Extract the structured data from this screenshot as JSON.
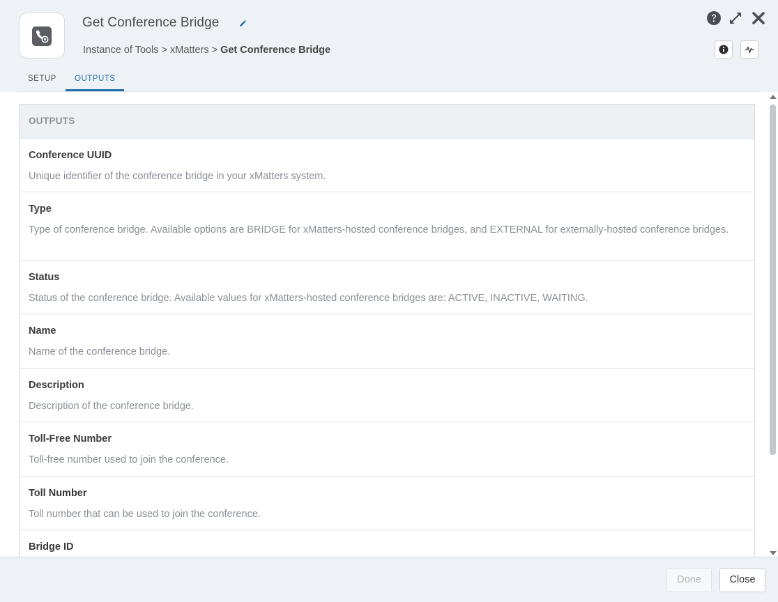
{
  "window": {
    "title": "Get Conference Bridge",
    "icon_name": "phone-gear-icon",
    "breadcrumb": {
      "items": [
        "Instance of Tools",
        "xMatters"
      ],
      "separator": ">",
      "current": "Get Conference Bridge"
    },
    "top_icons": [
      "help-icon",
      "expand-icon",
      "close-icon"
    ],
    "side_buttons": [
      "info-icon",
      "activity-icon"
    ]
  },
  "tabs": [
    {
      "label": "SETUP",
      "active": false
    },
    {
      "label": "OUTPUTS",
      "active": true
    }
  ],
  "outputs": {
    "header": "OUTPUTS",
    "items": [
      {
        "name": "Conference UUID",
        "description": "Unique identifier of the conference bridge in your xMatters system."
      },
      {
        "name": "Type",
        "description": "Type of conference bridge. Available options are BRIDGE for xMatters-hosted conference bridges, and EXTERNAL for externally-hosted conference bridges."
      },
      {
        "name": "Status",
        "description": "Status of the conference bridge. Available values for xMatters-hosted conference bridges are: ACTIVE, INACTIVE, WAITING."
      },
      {
        "name": "Name",
        "description": "Name of the conference bridge."
      },
      {
        "name": "Description",
        "description": "Description of the conference bridge."
      },
      {
        "name": "Toll-Free Number",
        "description": "Toll-free number used to join the conference."
      },
      {
        "name": "Toll Number",
        "description": "Toll number that can be used to join the conference."
      },
      {
        "name": "Bridge ID",
        "description": ""
      }
    ]
  },
  "footer": {
    "done_label": "Done",
    "close_label": "Close"
  },
  "colors": {
    "accent": "#1f6fa8",
    "background": "#eef2f6",
    "icon_dark": "#5a5d62"
  }
}
